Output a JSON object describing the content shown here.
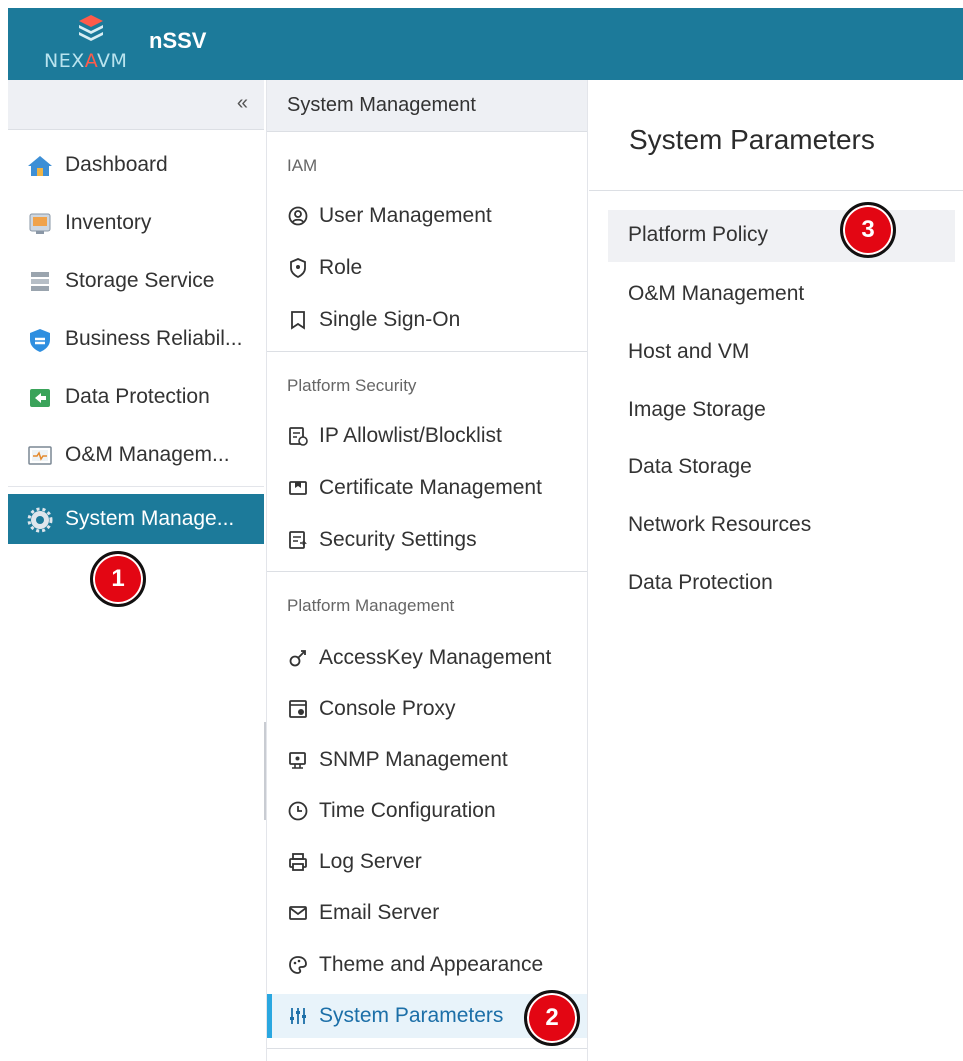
{
  "app": {
    "logo_text_main": "NEX",
    "logo_text_accent": "A",
    "logo_text_end": "VM",
    "title": "nSSV",
    "brand_color": "#1c7a9a",
    "logo_icon": "layers-stack-icon"
  },
  "left_nav": {
    "collapse_label": "«",
    "items": [
      {
        "label": "Dashboard",
        "icon": "home-icon"
      },
      {
        "label": "Inventory",
        "icon": "inventory-icon"
      },
      {
        "label": "Storage Service",
        "icon": "storage-icon"
      },
      {
        "label": "Business Reliabil...",
        "icon": "shield-icon"
      },
      {
        "label": "Data Protection",
        "icon": "data-protection-icon"
      },
      {
        "label": "O&M Managem...",
        "icon": "monitor-icon"
      },
      {
        "label": "System Manage...",
        "icon": "gear-icon",
        "active": true
      }
    ]
  },
  "mid_panel": {
    "header": "System Management",
    "groups": [
      {
        "title": "IAM",
        "items": [
          {
            "label": "User Management",
            "icon": "user-circle-icon"
          },
          {
            "label": "Role",
            "icon": "role-shield-icon"
          },
          {
            "label": "Single Sign-On",
            "icon": "bookmark-icon"
          }
        ]
      },
      {
        "title": "Platform Security",
        "items": [
          {
            "label": "IP Allowlist/Blocklist",
            "icon": "list-check-icon"
          },
          {
            "label": "Certificate Management",
            "icon": "certificate-icon"
          },
          {
            "label": "Security Settings",
            "icon": "settings-doc-icon"
          }
        ]
      },
      {
        "title": "Platform Management",
        "items": [
          {
            "label": "AccessKey Management",
            "icon": "key-icon"
          },
          {
            "label": "Console Proxy",
            "icon": "console-icon"
          },
          {
            "label": "SNMP Management",
            "icon": "snmp-icon"
          },
          {
            "label": "Time Configuration",
            "icon": "clock-icon"
          },
          {
            "label": "Log Server",
            "icon": "printer-icon"
          },
          {
            "label": "Email Server",
            "icon": "mail-icon"
          },
          {
            "label": "Theme and Appearance",
            "icon": "palette-icon"
          },
          {
            "label": "System Parameters",
            "icon": "sliders-icon",
            "active": true
          }
        ]
      }
    ]
  },
  "right_panel": {
    "title": "System Parameters",
    "items": [
      {
        "label": "Platform Policy",
        "selected": true
      },
      {
        "label": "O&M Management"
      },
      {
        "label": "Host and VM"
      },
      {
        "label": "Image Storage"
      },
      {
        "label": "Data Storage"
      },
      {
        "label": "Network Resources"
      },
      {
        "label": "Data Protection"
      }
    ]
  },
  "badges": [
    "1",
    "2",
    "3"
  ],
  "badge_color": "#e30613"
}
